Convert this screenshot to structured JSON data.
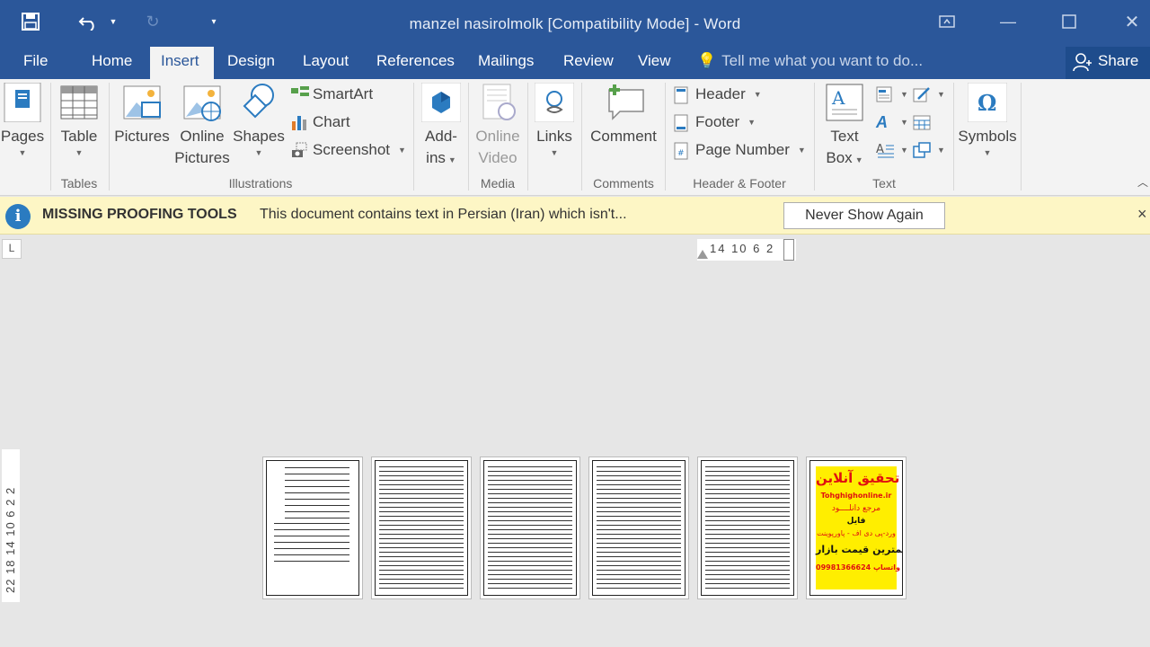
{
  "window": {
    "title": "manzel nasirolmolk [Compatibility Mode] - Word",
    "controls": [
      "ribbon-display-options",
      "minimize",
      "maximize",
      "close"
    ]
  },
  "quick_access": {
    "icons": [
      "save-icon",
      "undo-icon",
      "redo-icon",
      "customize-icon"
    ]
  },
  "tabs": {
    "file": "File",
    "home": "Home",
    "insert": "Insert",
    "design": "Design",
    "layout": "Layout",
    "references": "References",
    "mailings": "Mailings",
    "review": "Review",
    "view": "View",
    "active": "Insert"
  },
  "tell_me": {
    "placeholder": "Tell me what you want to do..."
  },
  "share": {
    "label": "Share"
  },
  "ribbon": {
    "pages": {
      "label": "Pages"
    },
    "tables": {
      "table": "Table",
      "group": "Tables"
    },
    "illustrations": {
      "pictures": "Pictures",
      "online_pictures_1": "Online",
      "online_pictures_2": "Pictures",
      "shapes": "Shapes",
      "smartart": "SmartArt",
      "chart": "Chart",
      "screenshot": "Screenshot",
      "group": "Illustrations"
    },
    "addins": {
      "label_1": "Add-",
      "label_2": "ins",
      "group": ""
    },
    "media": {
      "online_video_1": "Online",
      "online_video_2": "Video",
      "group": "Media"
    },
    "links": {
      "label": "Links"
    },
    "comments": {
      "comment": "Comment",
      "group": "Comments"
    },
    "header_footer": {
      "header": "Header",
      "footer": "Footer",
      "page_number": "Page Number",
      "group": "Header & Footer"
    },
    "text": {
      "text_box_1": "Text",
      "text_box_2": "Box",
      "group": "Text"
    },
    "symbols": {
      "label": "Symbols"
    }
  },
  "infobar": {
    "title": "MISSING PROOFING TOOLS",
    "message": "This document contains text in Persian (Iran) which isn't...",
    "button": "Never Show Again",
    "close": "×"
  },
  "rulers": {
    "corner": "L",
    "horizontal": "14 10 6 2",
    "vertical": "22 18 14 10 6 2 2"
  },
  "pages": {
    "count": 6,
    "ad": {
      "line1": "تحقیق آنلاین",
      "line2": "Tohghighonline.ir",
      "line3": "مرجع دانلــــود",
      "line4": "فایل",
      "line5": "ورد-پی دی اف - پاورپوینت",
      "line6": "با کمترین قیمت بازار",
      "line7": "09981366624 واتساپ"
    }
  },
  "colors": {
    "brand": "#2b579a",
    "infobar_bg": "#fdf6c5",
    "ad_bg": "#ffee00",
    "ad_red": "#e01010"
  }
}
